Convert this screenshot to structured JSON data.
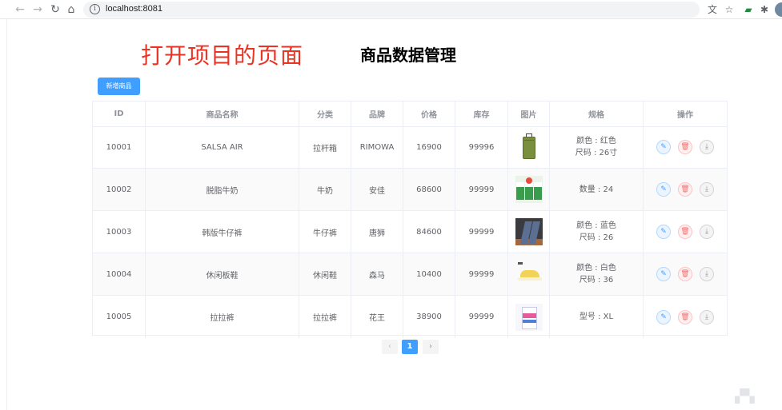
{
  "browser": {
    "url": "localhost:8081"
  },
  "page": {
    "red_title": "打开项目的页面",
    "title": "商品数据管理",
    "add_button": "新增商品"
  },
  "table": {
    "headers": [
      "ID",
      "商品名称",
      "分类",
      "品牌",
      "价格",
      "库存",
      "图片",
      "规格",
      "操作"
    ],
    "rows": [
      {
        "id": "10001",
        "name": "SALSA AIR",
        "category": "拉杆箱",
        "brand": "RIMOWA",
        "price": "16900",
        "stock": "99996",
        "image": "suitcase",
        "spec": [
          "颜色 : 红色",
          "尺码 : 26寸"
        ]
      },
      {
        "id": "10002",
        "name": "脱脂牛奶",
        "category": "牛奶",
        "brand": "安佳",
        "price": "68600",
        "stock": "99999",
        "image": "milk",
        "spec": [
          "数量 : 24"
        ]
      },
      {
        "id": "10003",
        "name": "韩版牛仔裤",
        "category": "牛仔裤",
        "brand": "唐狮",
        "price": "84600",
        "stock": "99999",
        "image": "jeans",
        "spec": [
          "颜色 : 蓝色",
          "尺码 : 26"
        ]
      },
      {
        "id": "10004",
        "name": "休闲板鞋",
        "category": "休闲鞋",
        "brand": "森马",
        "price": "10400",
        "stock": "99999",
        "image": "shoe",
        "spec": [
          "颜色 : 白色",
          "尺码 : 36"
        ]
      },
      {
        "id": "10005",
        "name": "拉拉裤",
        "category": "拉拉裤",
        "brand": "花王",
        "price": "38900",
        "stock": "99999",
        "image": "diaper",
        "spec": [
          "型号 : XL"
        ]
      }
    ]
  },
  "pagination": {
    "prev": "‹",
    "current": "1",
    "next": "›"
  },
  "icons": {
    "edit": "edit-icon",
    "delete": "delete-icon",
    "download": "download-icon"
  },
  "colors": {
    "primary": "#409eff",
    "danger": "#f56c6c",
    "red_title": "#ea3323"
  }
}
